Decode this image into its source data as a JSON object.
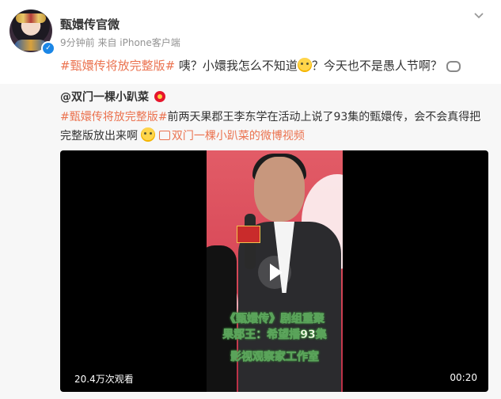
{
  "post": {
    "author": "甄嬛传官微",
    "meta": "9分钟前  来自 iPhone客户端",
    "hashtag": "#甄嬛传将放完整版#",
    "text1": " 咦？小嬛我怎么不知道",
    "text2": "？今天也不是愚人节啊？",
    "avatar_icon": "avatar-image",
    "verified_icon": "verified-badge-icon"
  },
  "repost": {
    "author": "@双门一棵小趴菜",
    "hashtag": "#甄嬛传将放完整版#",
    "text": "前两天果郡王李东学在活动上说了93集的甄嬛传，会不会真得把完整版放出来啊",
    "video_link": "双门一棵小趴菜的微博视频",
    "video": {
      "caption1": "《甄嬛传》剧组重聚",
      "caption2": "果郡王：希望播93集",
      "caption3": "影视观察家工作室",
      "views": "20.4万次观看",
      "duration": "00:20"
    }
  },
  "colors": {
    "accent": "#eb7350",
    "repost_bg": "#f7f7f7",
    "meta_text": "#939393"
  }
}
